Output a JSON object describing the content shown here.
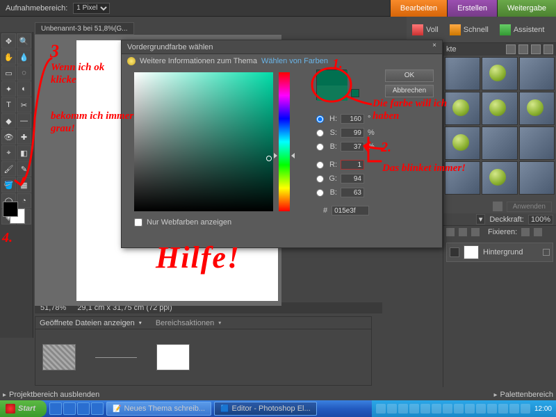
{
  "topbar": {
    "range_label": "Aufnahmebereich:",
    "range_value": "1 Pixel"
  },
  "main_tabs": {
    "edit": "Bearbeiten",
    "create": "Erstellen",
    "share": "Weitergabe"
  },
  "modes": {
    "full": "Voll",
    "quick": "Schnell",
    "assist": "Assistent"
  },
  "document": {
    "tab": "Unbenannt-3 bei 51,8%(G...",
    "zoom": "51,78%",
    "dims": "29,1 cm x 31,75 cm (72 ppi)"
  },
  "dialog": {
    "title": "Vordergrundfarbe wählen",
    "info_text": "Weitere Informationen zum Thema",
    "info_link": "Wählen von Farben",
    "ok": "OK",
    "cancel": "Abbrechen",
    "webonly": "Nur Webfarben anzeigen",
    "H": {
      "lbl": "H:",
      "v": "160",
      "u": "°"
    },
    "S": {
      "lbl": "S:",
      "v": "99",
      "u": "%"
    },
    "Bv": {
      "lbl": "B:",
      "v": "37",
      "u": "%"
    },
    "R": {
      "lbl": "R:",
      "v": "1"
    },
    "G": {
      "lbl": "G:",
      "v": "94"
    },
    "Bb": {
      "lbl": "B:",
      "v": "63"
    },
    "hex_lbl": "#",
    "hex": "015e3f"
  },
  "effects": {
    "tab": "kte",
    "apply": "Anwenden"
  },
  "layers": {
    "opacity_label": "Deckkraft:",
    "opacity": "100%",
    "lock_label": "Fixieren:",
    "bg": "Hintergrund"
  },
  "bin": {
    "open_files": "Geöffnete Dateien anzeigen",
    "actions": "Bereichsaktionen"
  },
  "footer": {
    "hide": "Projektbereich ausblenden",
    "palette": "Palettenbereich"
  },
  "taskbar": {
    "start": "Start",
    "t1": "Neues Thema schreib...",
    "t2": "Editor - Photoshop El...",
    "clock": "12:00"
  },
  "anno": {
    "n3": "3",
    "a": "Wenn ich ok klicke",
    "b": "bekomm ich immer grau!",
    "n4": "4.",
    "n1": "1.",
    "c": "Die farbe will ich haben",
    "n2": "2.",
    "d": "Das blinket immer!",
    "hilfe": "Hilfe!"
  }
}
